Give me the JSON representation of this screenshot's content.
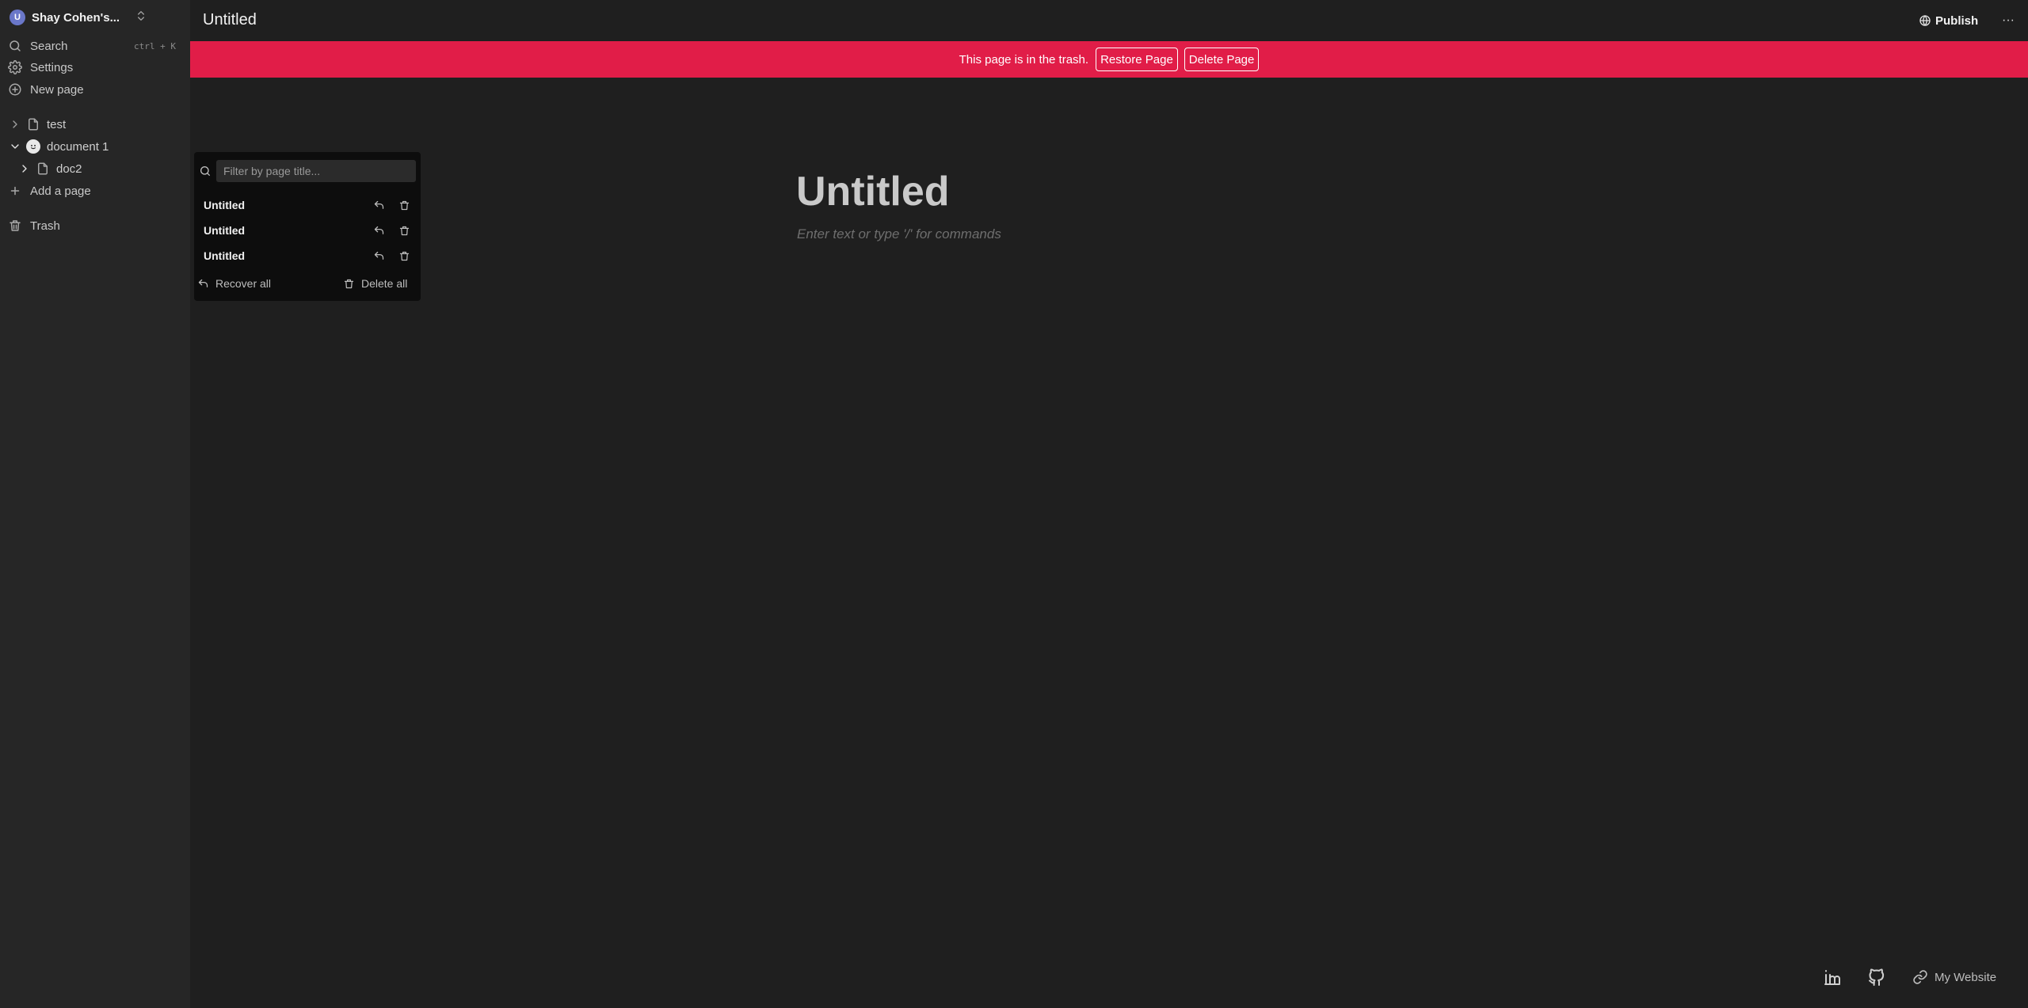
{
  "workspace": {
    "initial": "U",
    "name": "Shay Cohen's..."
  },
  "sidebar": {
    "search": {
      "label": "Search",
      "shortcut": "ctrl + K"
    },
    "settings": {
      "label": "Settings"
    },
    "new_page": {
      "label": "New page"
    },
    "tree": [
      {
        "label": "test",
        "expanded": false,
        "icon": "file-icon"
      },
      {
        "label": "document 1",
        "expanded": true,
        "icon": "face-emoji-icon"
      },
      {
        "label": "doc2",
        "expanded": false,
        "icon": "file-icon"
      }
    ],
    "add_page": {
      "label": "Add a page"
    },
    "trash": {
      "label": "Trash"
    }
  },
  "header": {
    "title": "Untitled",
    "publish_label": "Publish",
    "more_label": "···"
  },
  "banner": {
    "message": "This page is in the trash.",
    "restore_label": "Restore Page",
    "delete_label": "Delete Page",
    "color": "#e11d48"
  },
  "editor": {
    "title": "Untitled",
    "placeholder": "Enter text or type '/' for commands"
  },
  "trash_popover": {
    "filter_placeholder": "Filter by page title...",
    "items": [
      {
        "title": "Untitled"
      },
      {
        "title": "Untitled"
      },
      {
        "title": "Untitled"
      }
    ],
    "recover_all_label": "Recover all",
    "delete_all_label": "Delete all"
  },
  "footer": {
    "website_label": "My Website"
  }
}
